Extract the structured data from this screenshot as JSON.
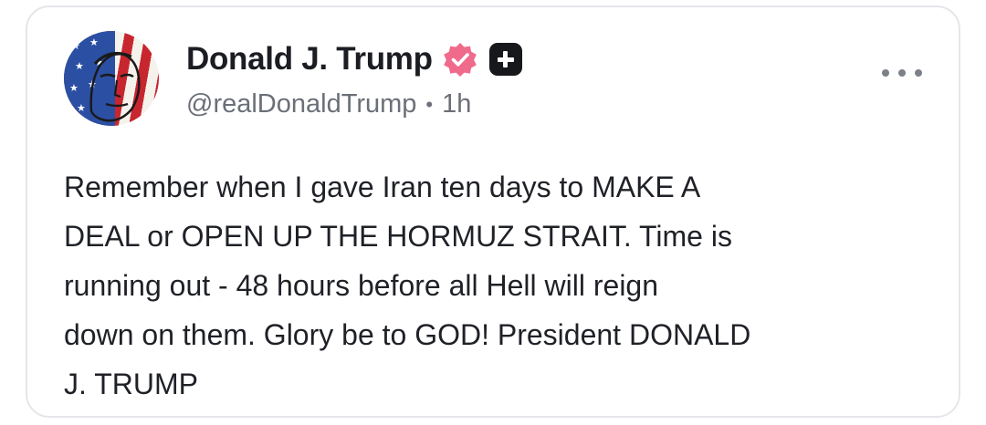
{
  "post": {
    "author_name": "Donald J. Trump",
    "handle": "@realDonaldTrump",
    "separator": "•",
    "time": "1h",
    "body_lines": [
      "Remember when I gave Iran ten days to MAKE A",
      "DEAL or OPEN UP THE HORMUZ STRAIT. Time is",
      "running out - 48 hours before all Hell will reign",
      "down on them. Glory be to GOD! President DONALD",
      "J. TRUMP"
    ]
  },
  "icons": {
    "verified": "verified-badge-icon",
    "plus": "plus-badge-icon",
    "more": "more-options-icon"
  },
  "colors": {
    "verified_badge": "#f06a8c",
    "text": "#1f2127",
    "secondary_text": "#6b6f78"
  }
}
